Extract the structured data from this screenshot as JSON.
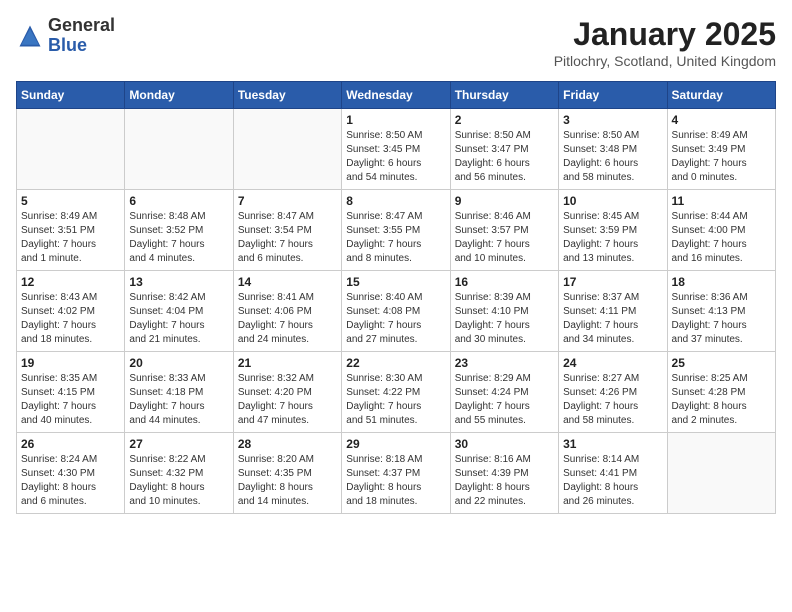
{
  "header": {
    "logo_general": "General",
    "logo_blue": "Blue",
    "month_title": "January 2025",
    "location": "Pitlochry, Scotland, United Kingdom"
  },
  "weekdays": [
    "Sunday",
    "Monday",
    "Tuesday",
    "Wednesday",
    "Thursday",
    "Friday",
    "Saturday"
  ],
  "weeks": [
    [
      {
        "day": "",
        "info": ""
      },
      {
        "day": "",
        "info": ""
      },
      {
        "day": "",
        "info": ""
      },
      {
        "day": "1",
        "info": "Sunrise: 8:50 AM\nSunset: 3:45 PM\nDaylight: 6 hours\nand 54 minutes."
      },
      {
        "day": "2",
        "info": "Sunrise: 8:50 AM\nSunset: 3:47 PM\nDaylight: 6 hours\nand 56 minutes."
      },
      {
        "day": "3",
        "info": "Sunrise: 8:50 AM\nSunset: 3:48 PM\nDaylight: 6 hours\nand 58 minutes."
      },
      {
        "day": "4",
        "info": "Sunrise: 8:49 AM\nSunset: 3:49 PM\nDaylight: 7 hours\nand 0 minutes."
      }
    ],
    [
      {
        "day": "5",
        "info": "Sunrise: 8:49 AM\nSunset: 3:51 PM\nDaylight: 7 hours\nand 1 minute."
      },
      {
        "day": "6",
        "info": "Sunrise: 8:48 AM\nSunset: 3:52 PM\nDaylight: 7 hours\nand 4 minutes."
      },
      {
        "day": "7",
        "info": "Sunrise: 8:47 AM\nSunset: 3:54 PM\nDaylight: 7 hours\nand 6 minutes."
      },
      {
        "day": "8",
        "info": "Sunrise: 8:47 AM\nSunset: 3:55 PM\nDaylight: 7 hours\nand 8 minutes."
      },
      {
        "day": "9",
        "info": "Sunrise: 8:46 AM\nSunset: 3:57 PM\nDaylight: 7 hours\nand 10 minutes."
      },
      {
        "day": "10",
        "info": "Sunrise: 8:45 AM\nSunset: 3:59 PM\nDaylight: 7 hours\nand 13 minutes."
      },
      {
        "day": "11",
        "info": "Sunrise: 8:44 AM\nSunset: 4:00 PM\nDaylight: 7 hours\nand 16 minutes."
      }
    ],
    [
      {
        "day": "12",
        "info": "Sunrise: 8:43 AM\nSunset: 4:02 PM\nDaylight: 7 hours\nand 18 minutes."
      },
      {
        "day": "13",
        "info": "Sunrise: 8:42 AM\nSunset: 4:04 PM\nDaylight: 7 hours\nand 21 minutes."
      },
      {
        "day": "14",
        "info": "Sunrise: 8:41 AM\nSunset: 4:06 PM\nDaylight: 7 hours\nand 24 minutes."
      },
      {
        "day": "15",
        "info": "Sunrise: 8:40 AM\nSunset: 4:08 PM\nDaylight: 7 hours\nand 27 minutes."
      },
      {
        "day": "16",
        "info": "Sunrise: 8:39 AM\nSunset: 4:10 PM\nDaylight: 7 hours\nand 30 minutes."
      },
      {
        "day": "17",
        "info": "Sunrise: 8:37 AM\nSunset: 4:11 PM\nDaylight: 7 hours\nand 34 minutes."
      },
      {
        "day": "18",
        "info": "Sunrise: 8:36 AM\nSunset: 4:13 PM\nDaylight: 7 hours\nand 37 minutes."
      }
    ],
    [
      {
        "day": "19",
        "info": "Sunrise: 8:35 AM\nSunset: 4:15 PM\nDaylight: 7 hours\nand 40 minutes."
      },
      {
        "day": "20",
        "info": "Sunrise: 8:33 AM\nSunset: 4:18 PM\nDaylight: 7 hours\nand 44 minutes."
      },
      {
        "day": "21",
        "info": "Sunrise: 8:32 AM\nSunset: 4:20 PM\nDaylight: 7 hours\nand 47 minutes."
      },
      {
        "day": "22",
        "info": "Sunrise: 8:30 AM\nSunset: 4:22 PM\nDaylight: 7 hours\nand 51 minutes."
      },
      {
        "day": "23",
        "info": "Sunrise: 8:29 AM\nSunset: 4:24 PM\nDaylight: 7 hours\nand 55 minutes."
      },
      {
        "day": "24",
        "info": "Sunrise: 8:27 AM\nSunset: 4:26 PM\nDaylight: 7 hours\nand 58 minutes."
      },
      {
        "day": "25",
        "info": "Sunrise: 8:25 AM\nSunset: 4:28 PM\nDaylight: 8 hours\nand 2 minutes."
      }
    ],
    [
      {
        "day": "26",
        "info": "Sunrise: 8:24 AM\nSunset: 4:30 PM\nDaylight: 8 hours\nand 6 minutes."
      },
      {
        "day": "27",
        "info": "Sunrise: 8:22 AM\nSunset: 4:32 PM\nDaylight: 8 hours\nand 10 minutes."
      },
      {
        "day": "28",
        "info": "Sunrise: 8:20 AM\nSunset: 4:35 PM\nDaylight: 8 hours\nand 14 minutes."
      },
      {
        "day": "29",
        "info": "Sunrise: 8:18 AM\nSunset: 4:37 PM\nDaylight: 8 hours\nand 18 minutes."
      },
      {
        "day": "30",
        "info": "Sunrise: 8:16 AM\nSunset: 4:39 PM\nDaylight: 8 hours\nand 22 minutes."
      },
      {
        "day": "31",
        "info": "Sunrise: 8:14 AM\nSunset: 4:41 PM\nDaylight: 8 hours\nand 26 minutes."
      },
      {
        "day": "",
        "info": ""
      }
    ]
  ]
}
